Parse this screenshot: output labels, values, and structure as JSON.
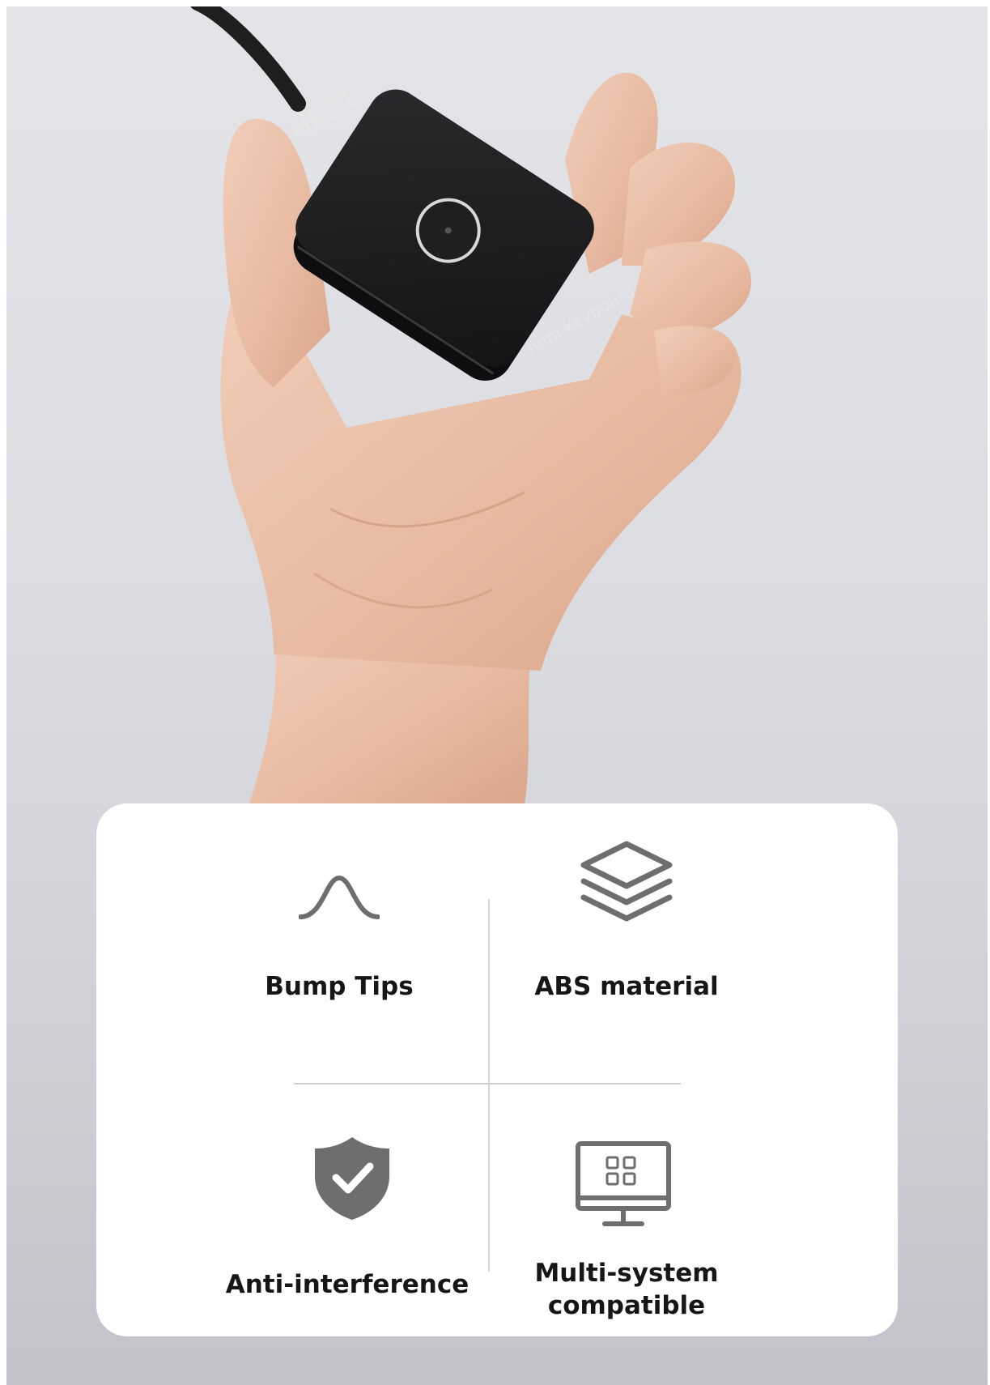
{
  "device": {
    "model_label": "HK31",
    "product_label": "mini keyboard"
  },
  "features": [
    {
      "label": "Bump Tips",
      "icon": "bell-curve-icon"
    },
    {
      "label": "ABS material",
      "icon": "layers-icon"
    },
    {
      "label": "Anti-interference",
      "icon": "shield-check-icon"
    },
    {
      "label": "Multi-system\ncompatible",
      "icon": "monitor-icon"
    }
  ],
  "colors": {
    "icon_gray": "#6e6e6e",
    "device_black": "#1c1c1e",
    "card_bg": "#ffffff"
  }
}
